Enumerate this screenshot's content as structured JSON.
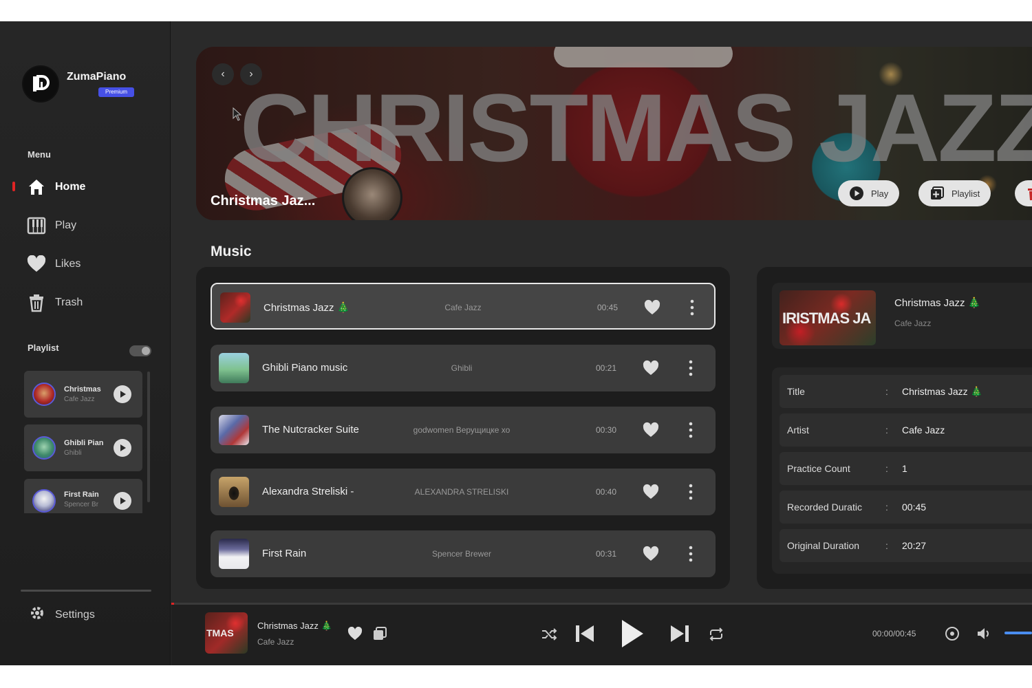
{
  "app": {
    "name": "ZumaPiano",
    "badge": "Premium"
  },
  "sidebar": {
    "menu_label": "Menu",
    "items": [
      {
        "label": "Home",
        "icon": "home-icon",
        "active": true
      },
      {
        "label": "Play",
        "icon": "piano-icon",
        "active": false
      },
      {
        "label": "Likes",
        "icon": "heart-icon",
        "active": false
      },
      {
        "label": "Trash",
        "icon": "trash-icon",
        "active": false
      }
    ],
    "playlist_label": "Playlist",
    "playlists": [
      {
        "title": "Christmas",
        "sub": "Cafe Jazz"
      },
      {
        "title": "Ghibli Pian",
        "sub": "Ghibli"
      },
      {
        "title": "First Rain",
        "sub": "Spencer Br"
      }
    ],
    "settings_label": "Settings"
  },
  "banner": {
    "big_title": "CHRISTMAS JAZZ",
    "name": "Christmas Jaz...",
    "play_label": "Play",
    "playlist_label": "Playlist"
  },
  "music": {
    "heading": "Music",
    "tracks": [
      {
        "title": "Christmas Jazz 🎄",
        "artist": "Cafe Jazz",
        "duration": "00:45",
        "selected": true
      },
      {
        "title": "Ghibli Piano music",
        "artist": "Ghibli",
        "duration": "00:21",
        "selected": false
      },
      {
        "title": "The Nutcracker Suite",
        "artist": "godwomen Верущицке хо",
        "duration": "00:30",
        "selected": false
      },
      {
        "title": "Alexandra Streliski - ",
        "artist": "ALEXANDRA STRELISKI",
        "duration": "00:40",
        "selected": false
      },
      {
        "title": "First Rain",
        "artist": "Spencer Brewer",
        "duration": "00:31",
        "selected": false
      }
    ]
  },
  "detail": {
    "thumb_text": "IRISTMAS JA",
    "title": "Christmas Jazz 🎄",
    "artist": "Cafe Jazz",
    "rows": [
      {
        "key": "Title",
        "value": "Christmas Jazz 🎄"
      },
      {
        "key": "Artist",
        "value": "Cafe Jazz"
      },
      {
        "key": "Practice Count",
        "value": "1"
      },
      {
        "key": "Recorded Duratic",
        "value": "00:45"
      },
      {
        "key": "Original Duration",
        "value": "20:27"
      }
    ]
  },
  "player": {
    "thumb_text": "TMAS",
    "title": "Christmas Jazz 🎄",
    "artist": "Cafe Jazz",
    "time": "00:00/00:45",
    "progress": 0.0
  },
  "colors": {
    "accent_red": "#e02424",
    "premium_blue": "#4650e6",
    "volume_blue": "#4a8df0"
  }
}
